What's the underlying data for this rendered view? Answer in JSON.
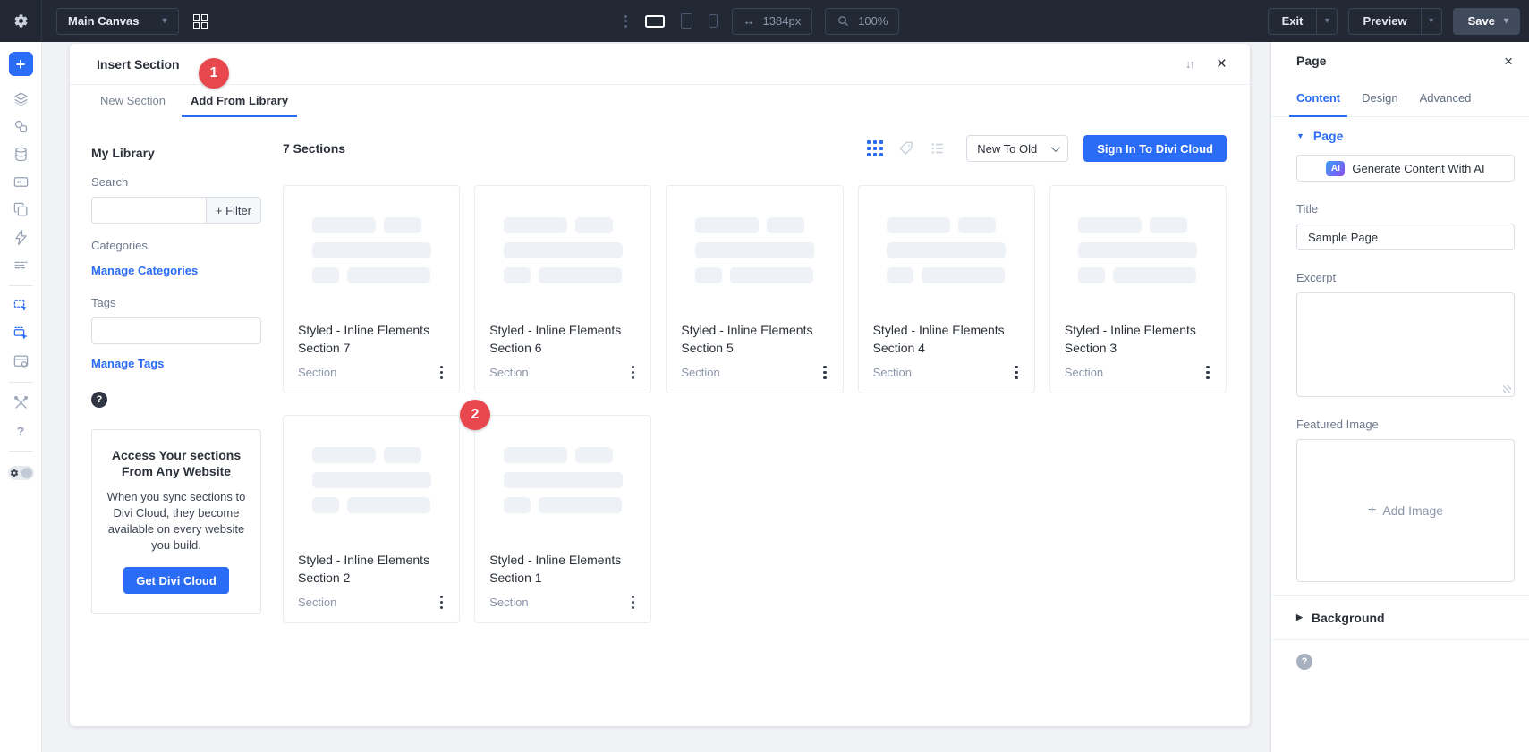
{
  "topbar": {
    "canvas_selector": "Main Canvas",
    "width_value": "1384px",
    "zoom_value": "100%",
    "exit_label": "Exit",
    "preview_label": "Preview",
    "save_label": "Save"
  },
  "left_toolbar": {
    "items": [
      "add",
      "layers",
      "design-shapes",
      "database",
      "field-card",
      "copy-pages",
      "lightning",
      "text-rows",
      "insert-section",
      "insert-row",
      "page-layout",
      "utilities",
      "help",
      "settings-toggle"
    ]
  },
  "annotations": {
    "step1": "1",
    "step2": "2"
  },
  "modal": {
    "title": "Insert Section",
    "tabs": [
      {
        "label": "New Section",
        "active": false
      },
      {
        "label": "Add From Library",
        "active": true
      }
    ],
    "library": {
      "title": "My Library",
      "search_label": "Search",
      "filter_button": "+ Filter",
      "categories_label": "Categories",
      "manage_categories": "Manage Categories",
      "tags_label": "Tags",
      "manage_tags": "Manage Tags",
      "promo": {
        "heading": "Access Your sections From Any Website",
        "body": "When you sync sections to Divi Cloud, they become available on every website you build.",
        "cta": "Get Divi Cloud"
      }
    },
    "content": {
      "count_label": "7 Sections",
      "sort_value": "New To Old",
      "signin_button": "Sign In To Divi Cloud",
      "cards": [
        {
          "title": "Styled - Inline Elements Section 7",
          "type": "Section"
        },
        {
          "title": "Styled - Inline Elements Section 6",
          "type": "Section"
        },
        {
          "title": "Styled - Inline Elements Section 5",
          "type": "Section"
        },
        {
          "title": "Styled - Inline Elements Section 4",
          "type": "Section"
        },
        {
          "title": "Styled - Inline Elements Section 3",
          "type": "Section"
        },
        {
          "title": "Styled - Inline Elements Section 2",
          "type": "Section"
        },
        {
          "title": "Styled - Inline Elements Section 1",
          "type": "Section"
        }
      ]
    }
  },
  "panel": {
    "title": "Page",
    "tabs": [
      {
        "label": "Content",
        "active": true
      },
      {
        "label": "Design",
        "active": false
      },
      {
        "label": "Advanced",
        "active": false
      }
    ],
    "page_section_label": "Page",
    "ai_button": {
      "chip": "AI",
      "label": "Generate Content With AI"
    },
    "title_field": {
      "label": "Title",
      "value": "Sample Page"
    },
    "excerpt_field": {
      "label": "Excerpt",
      "value": ""
    },
    "featured_image": {
      "label": "Featured Image",
      "add_label": "Add Image"
    },
    "background_section_label": "Background"
  },
  "glyphs": {
    "close": "×",
    "sort": "↓↑",
    "help": "?",
    "plus": "+",
    "chevron_down": "▾",
    "triangle_down": "▼",
    "triangle_right": "▶",
    "width_arrows": "↔"
  },
  "colors": {
    "accent_blue": "#2b6cf7",
    "badge_red": "#e8484d",
    "topbar_bg": "#222834",
    "save_button_bg": "#3f4a5c"
  }
}
